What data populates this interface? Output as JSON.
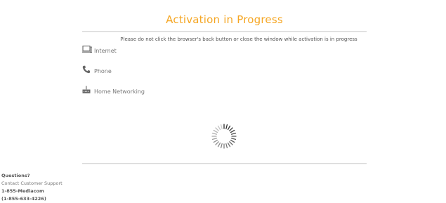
{
  "page": {
    "title": "Activation in Progress",
    "warning": "Please do not click the browser's back button or close the window while activation is in progress"
  },
  "services": [
    {
      "label": "Internet",
      "icon": "computer-icon"
    },
    {
      "label": "Phone",
      "icon": "phone-icon"
    },
    {
      "label": "Home Networking",
      "icon": "router-icon"
    }
  ],
  "status": {
    "icon": "loading-spinner"
  },
  "support": {
    "heading": "Questions?",
    "contact_text": "Contact Customer Support",
    "phone_word": "1-855-Mediacom",
    "phone_number": "(1-855-633-4226)"
  },
  "colors": {
    "accent": "#f5a623",
    "text": "#666666",
    "divider": "#d9d9d9"
  }
}
